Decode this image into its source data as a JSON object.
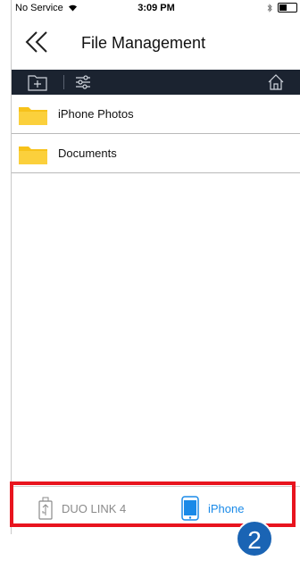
{
  "status_bar": {
    "carrier": "No Service",
    "time": "3:09 PM"
  },
  "nav": {
    "title": "File Management"
  },
  "toolbar": {
    "icons": [
      "new-folder-icon",
      "sliders-icon",
      "home-icon"
    ]
  },
  "files": [
    {
      "name": "iPhone Photos",
      "icon": "folder-icon"
    },
    {
      "name": "Documents",
      "icon": "folder-icon"
    }
  ],
  "tabbar": {
    "tabs": [
      {
        "label": "DUO LINK 4",
        "icon": "usb-drive-icon",
        "selected": false
      },
      {
        "label": "iPhone",
        "icon": "phone-icon",
        "selected": true
      }
    ]
  },
  "annotation": {
    "step": "2",
    "highlight_color": "#e8141e",
    "badge_color": "#1a64b4"
  },
  "colors": {
    "toolbar_bg": "#1b2330",
    "folder": "#f7c21a",
    "active_tab": "#1a8ae8"
  }
}
